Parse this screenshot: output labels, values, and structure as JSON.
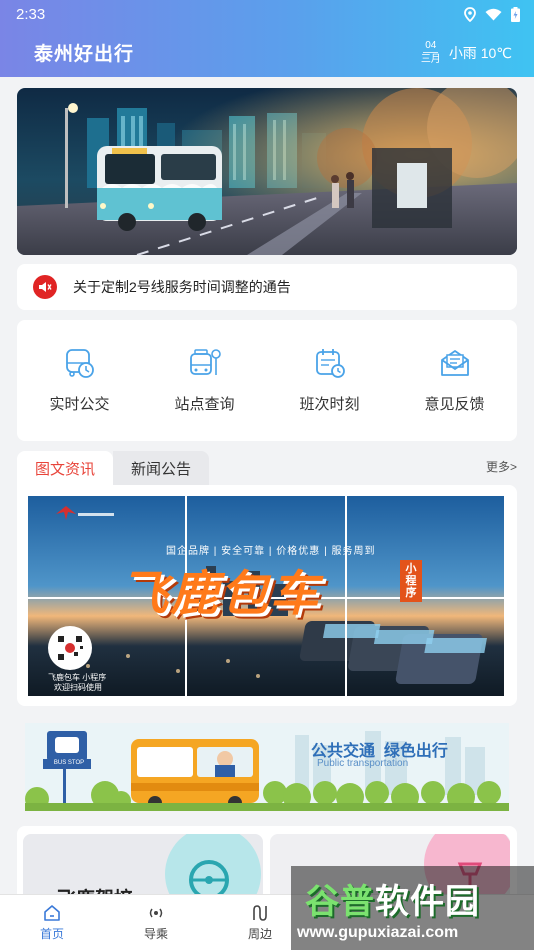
{
  "status_bar": {
    "time": "2:33"
  },
  "header": {
    "title": "泰州好出行",
    "date_day": "04",
    "date_month": "三月",
    "weather": "小雨 10℃"
  },
  "notice": {
    "text": "关于定制2号线服务时间调整的通告"
  },
  "quick_menu": [
    {
      "label": "实时公交",
      "icon": "bus-clock-icon"
    },
    {
      "label": "站点查询",
      "icon": "bus-stop-icon"
    },
    {
      "label": "班次时刻",
      "icon": "calendar-clock-icon"
    },
    {
      "label": "意见反馈",
      "icon": "feedback-mail-icon"
    }
  ],
  "news": {
    "tabs": [
      "图文资讯",
      "新闻公告"
    ],
    "more": "更多>",
    "poster_title": "飞鹿包车",
    "poster_badge": "小程序",
    "poster_slogan": "国企品牌 | 安全可靠 | 价格优惠 | 服务周到",
    "poster_qr_caption_1": "飞鹿包车  小程序",
    "poster_qr_caption_2": "欢迎扫码使用"
  },
  "promo": {
    "headline": "公共交通  绿色出行",
    "subline": "Public transportation",
    "sign": "BUS STOP"
  },
  "bottom_cards": {
    "left_title": "飞鹿驾培"
  },
  "tab_bar": [
    {
      "label": "首页",
      "icon": "home-icon"
    },
    {
      "label": "导乘",
      "icon": "signal-icon"
    },
    {
      "label": "周边",
      "icon": "route-icon"
    }
  ],
  "watermark": {
    "text_green": "谷普",
    "text_white": "软件园",
    "url": "www.gupuxiazai.com"
  },
  "colors": {
    "header_start": "#7a85e6",
    "header_end": "#3fc3f2",
    "accent_red": "#e8443a",
    "tab_active": "#3a79d8"
  }
}
